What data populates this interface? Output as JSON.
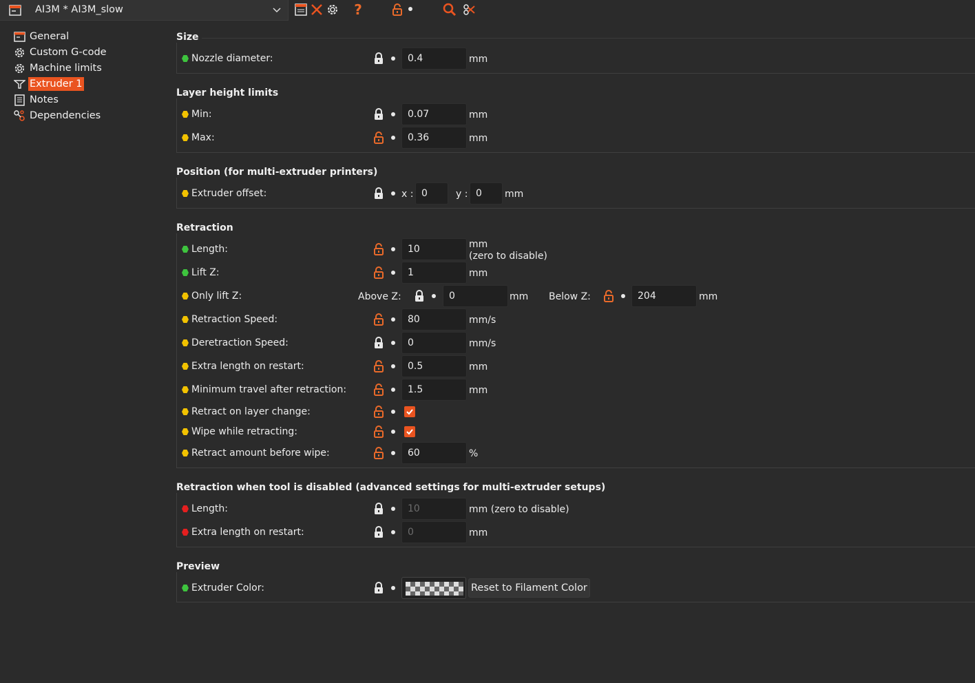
{
  "preset": {
    "name": "AI3M * AI3M_slow"
  },
  "sidebar": {
    "items": [
      {
        "label": "General"
      },
      {
        "label": "Custom G-code"
      },
      {
        "label": "Machine limits"
      },
      {
        "label": "Extruder 1"
      },
      {
        "label": "Notes"
      },
      {
        "label": "Dependencies"
      }
    ],
    "selected": "Extruder 1"
  },
  "sections": {
    "size": {
      "title": "Size",
      "nozzle_diameter": {
        "label": "Nozzle diameter:",
        "value": "0.4",
        "unit": "mm"
      }
    },
    "layer_height": {
      "title": "Layer height limits",
      "min": {
        "label": "Min:",
        "value": "0.07",
        "unit": "mm"
      },
      "max": {
        "label": "Max:",
        "value": "0.36",
        "unit": "mm"
      }
    },
    "position": {
      "title": "Position (for multi-extruder printers)",
      "extruder_offset": {
        "label": "Extruder offset:",
        "x_label": "x :",
        "x": "0",
        "y_label": "y :",
        "y": "0",
        "unit": "mm"
      }
    },
    "retraction": {
      "title": "Retraction",
      "length": {
        "label": "Length:",
        "value": "10",
        "unit": "mm",
        "note": "(zero to disable)"
      },
      "lift_z": {
        "label": "Lift Z:",
        "value": "1",
        "unit": "mm"
      },
      "only_lift_z": {
        "label": "Only lift Z:",
        "above_label": "Above Z:",
        "above": "0",
        "above_unit": "mm",
        "below_label": "Below Z:",
        "below": "204",
        "below_unit": "mm"
      },
      "retraction_speed": {
        "label": "Retraction Speed:",
        "value": "80",
        "unit": "mm/s"
      },
      "deretraction_speed": {
        "label": "Deretraction Speed:",
        "value": "0",
        "unit": "mm/s"
      },
      "extra_length": {
        "label": "Extra length on restart:",
        "value": "0.5",
        "unit": "mm"
      },
      "min_travel": {
        "label": "Minimum travel after retraction:",
        "value": "1.5",
        "unit": "mm"
      },
      "retract_layer_change": {
        "label": "Retract on layer change:",
        "checked": true
      },
      "wipe": {
        "label": "Wipe while retracting:",
        "checked": true
      },
      "retract_before_wipe": {
        "label": "Retract amount before wipe:",
        "value": "60",
        "unit": "%"
      }
    },
    "retraction_disabled": {
      "title": "Retraction when tool is disabled (advanced settings for multi-extruder setups)",
      "length": {
        "label": "Length:",
        "value": "10",
        "unit": "mm (zero to disable)"
      },
      "extra_length": {
        "label": "Extra length on restart:",
        "value": "0",
        "unit": "mm"
      }
    },
    "preview": {
      "title": "Preview",
      "extruder_color": {
        "label": "Extruder Color:",
        "reset_label": "Reset to Filament Color"
      }
    }
  },
  "colors": {
    "accent": "#ea5420",
    "lock_open": "#ea6a2a",
    "dot_green": "#3ec43e",
    "dot_yellow": "#f2c200",
    "dot_red": "#e51f1f"
  }
}
